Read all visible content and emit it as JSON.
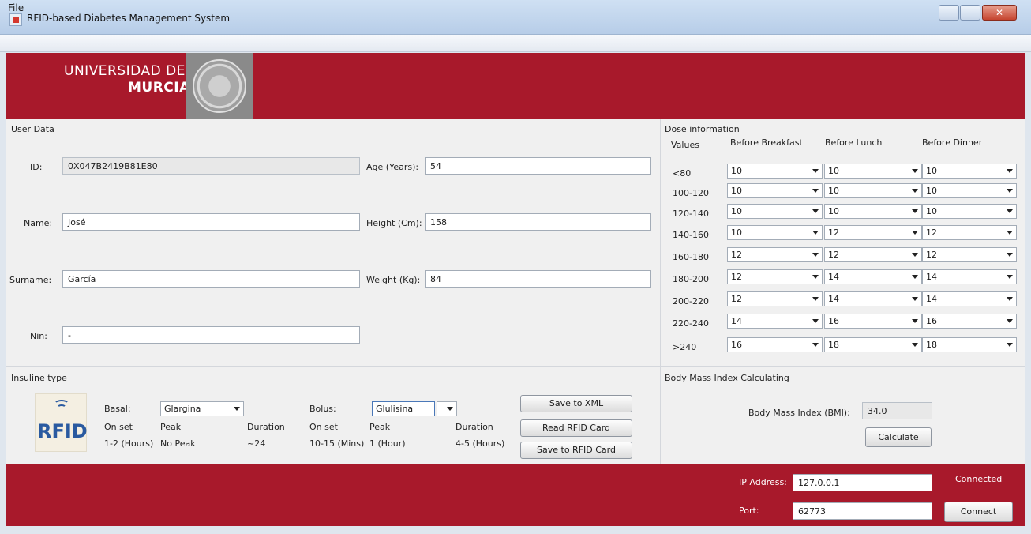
{
  "window": {
    "title": "RFID-based Diabetes Management System"
  },
  "menu": {
    "file": "File"
  },
  "banner": {
    "line1": "UNIVERSIDAD DE",
    "line2": "MURCIA"
  },
  "user_data": {
    "title": "User Data",
    "id_label": "ID:",
    "id_value": "0X047B2419B81E80",
    "name_label": "Name:",
    "name_value": "José",
    "surname_label": "Surname:",
    "surname_value": "García",
    "nin_label": "Nin:",
    "nin_value": "-",
    "age_label": "Age (Years):",
    "age_value": "54",
    "height_label": "Height (Cm):",
    "height_value": "158",
    "weight_label": "Weight (Kg):",
    "weight_value": "84"
  },
  "dose": {
    "title": "Dose information",
    "headers": {
      "values": "Values",
      "breakfast": "Before Breakfast",
      "lunch": "Before Lunch",
      "dinner": "Before Dinner"
    },
    "rows": [
      {
        "range": "<80",
        "b": "10",
        "l": "10",
        "d": "10"
      },
      {
        "range": "100-120",
        "b": "10",
        "l": "10",
        "d": "10"
      },
      {
        "range": "120-140",
        "b": "10",
        "l": "10",
        "d": "10"
      },
      {
        "range": "140-160",
        "b": "10",
        "l": "12",
        "d": "12"
      },
      {
        "range": "160-180",
        "b": "12",
        "l": "12",
        "d": "12"
      },
      {
        "range": "180-200",
        "b": "12",
        "l": "14",
        "d": "14"
      },
      {
        "range": "200-220",
        "b": "12",
        "l": "14",
        "d": "14"
      },
      {
        "range": "220-240",
        "b": "14",
        "l": "16",
        "d": "16"
      },
      {
        "range": ">240",
        "b": "16",
        "l": "18",
        "d": "18"
      }
    ]
  },
  "insuline": {
    "title": "Insuline type",
    "basal_label": "Basal:",
    "basal_value": "Glargina",
    "bolus_label": "Bolus:",
    "bolus_value": "Glulisina",
    "onset_label": "On set",
    "peak_label": "Peak",
    "duration_label": "Duration",
    "basal_onset": "1-2 (Hours)",
    "basal_peak": "No Peak",
    "basal_duration": "~24",
    "bolus_onset": "10-15 (Mins)",
    "bolus_peak": "1 (Hour)",
    "bolus_duration": "4-5 (Hours)",
    "logo_text": "RFID"
  },
  "buttons": {
    "save_xml": "Save to XML",
    "read_rfid": "Read RFID Card",
    "save_rfid": "Save to RFID Card",
    "calculate": "Calculate",
    "connect": "Connect"
  },
  "bmi": {
    "title": "Body Mass Index Calculating",
    "label": "Body Mass Index (BMI):",
    "value": "34.0"
  },
  "network": {
    "ip_label": "IP Address:",
    "ip_value": "127.0.0.1",
    "port_label": "Port:",
    "port_value": "62773",
    "status": "Connected"
  }
}
